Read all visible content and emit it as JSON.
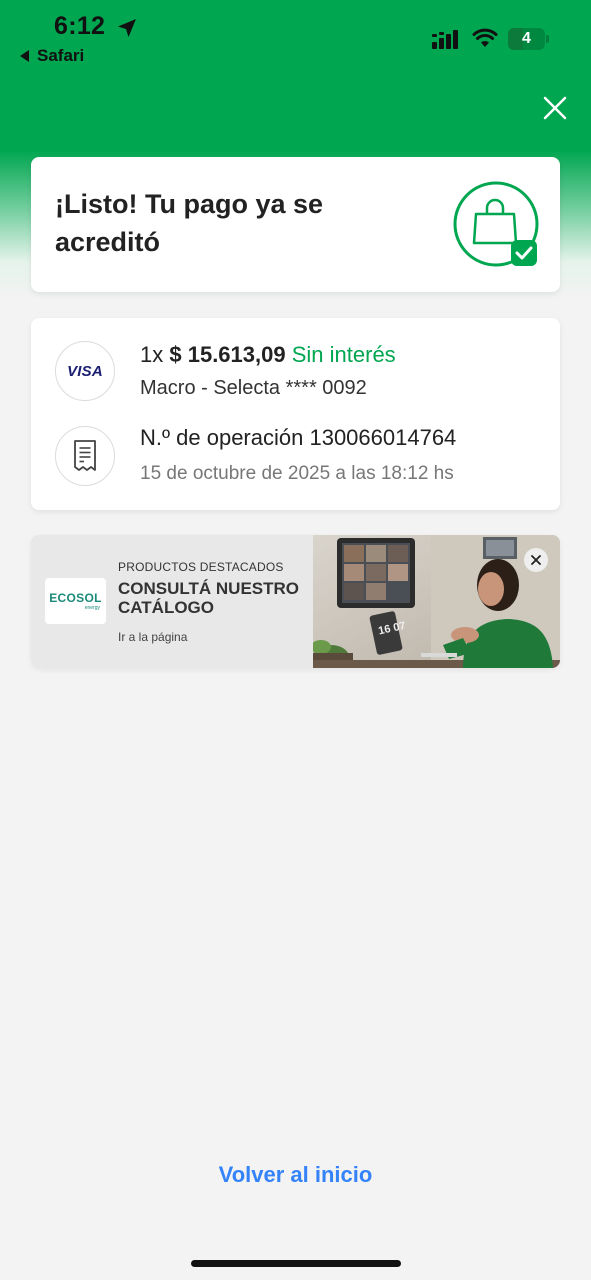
{
  "status_bar": {
    "time": "6:12",
    "back_app": "Safari",
    "battery": "4",
    "battery_level": 0.4
  },
  "success": {
    "title": "¡Listo! Tu pago ya se acreditó"
  },
  "payment": {
    "card_brand": "VISA",
    "installments": "1x",
    "amount": "$ 15.613,09",
    "interest": "Sin interés",
    "card_detail": "Macro - Selecta **** 0092",
    "operation": "N.º de operación 130066014764",
    "date": "15 de octubre de 2025 a las 18:12 hs"
  },
  "ad": {
    "logo_brand": "ECOSOL",
    "logo_sub": "energy",
    "eyebrow": "PRODUCTOS DESTACADOS",
    "title": "CONSULTÁ NUESTRO CATÁLOGO",
    "link": "Ir a la página",
    "calendar_text": "16 07"
  },
  "footer": {
    "home_link": "Volver al inicio"
  },
  "colors": {
    "brand_green": "#00a650",
    "link_blue": "#3483fa"
  }
}
